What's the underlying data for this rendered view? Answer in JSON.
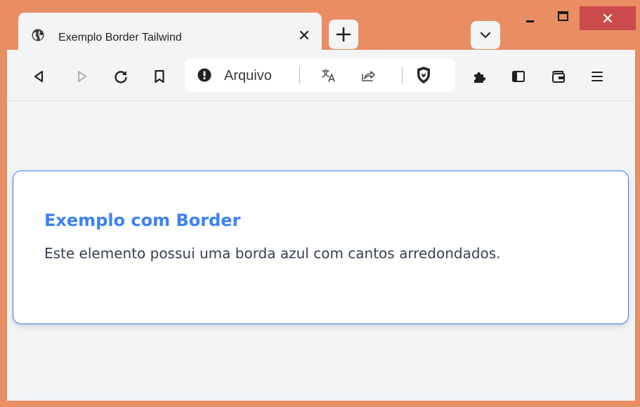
{
  "browser": {
    "tab": {
      "title": "Exemplo Border Tailwind",
      "favicon": "globe-icon"
    },
    "address_bar": {
      "security_label": "Arquivo"
    },
    "colors": {
      "frame": "#e98d63",
      "close_button": "#c94b4b",
      "toolbar": "#f3f4f6"
    }
  },
  "page": {
    "card": {
      "title": "Exemplo com Border",
      "text": "Este elemento possui uma borda azul com cantos arredondados."
    },
    "colors": {
      "accent": "#3b82f6",
      "text": "#374151",
      "background": "#f3f4f6"
    }
  }
}
